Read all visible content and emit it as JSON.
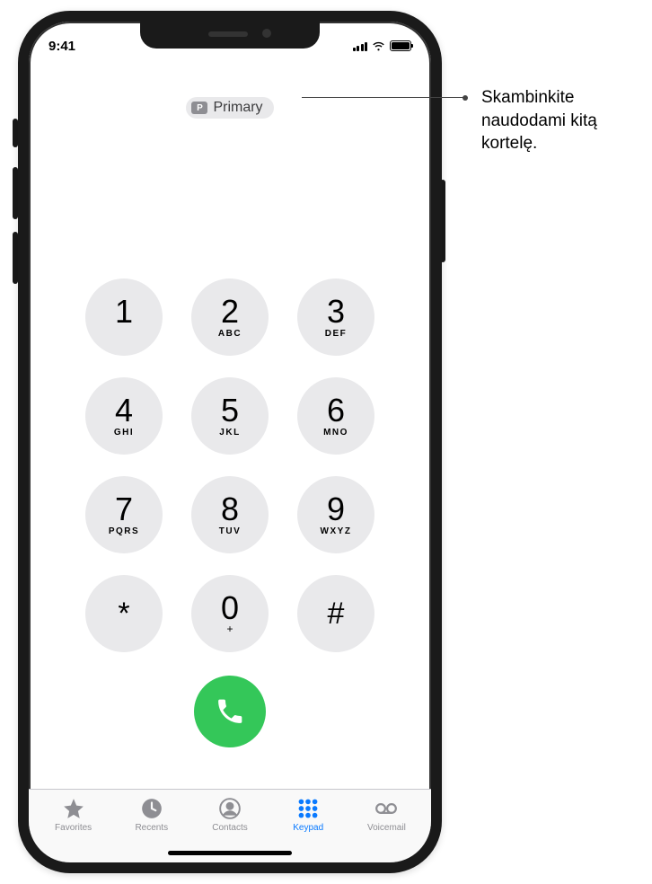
{
  "status": {
    "time": "9:41"
  },
  "sim": {
    "badge": "P",
    "label": "Primary"
  },
  "keys": [
    {
      "digit": "1",
      "letters": ""
    },
    {
      "digit": "2",
      "letters": "ABC"
    },
    {
      "digit": "3",
      "letters": "DEF"
    },
    {
      "digit": "4",
      "letters": "GHI"
    },
    {
      "digit": "5",
      "letters": "JKL"
    },
    {
      "digit": "6",
      "letters": "MNO"
    },
    {
      "digit": "7",
      "letters": "PQRS"
    },
    {
      "digit": "8",
      "letters": "TUV"
    },
    {
      "digit": "9",
      "letters": "WXYZ"
    },
    {
      "digit": "*",
      "letters": "",
      "symbol": true
    },
    {
      "digit": "0",
      "letters": "+",
      "plus": true
    },
    {
      "digit": "#",
      "letters": "",
      "symbol": true
    }
  ],
  "tabs": {
    "favorites": "Favorites",
    "recents": "Recents",
    "contacts": "Contacts",
    "keypad": "Keypad",
    "voicemail": "Voicemail"
  },
  "callout": "Skambinkite naudodami kitą kortelę."
}
